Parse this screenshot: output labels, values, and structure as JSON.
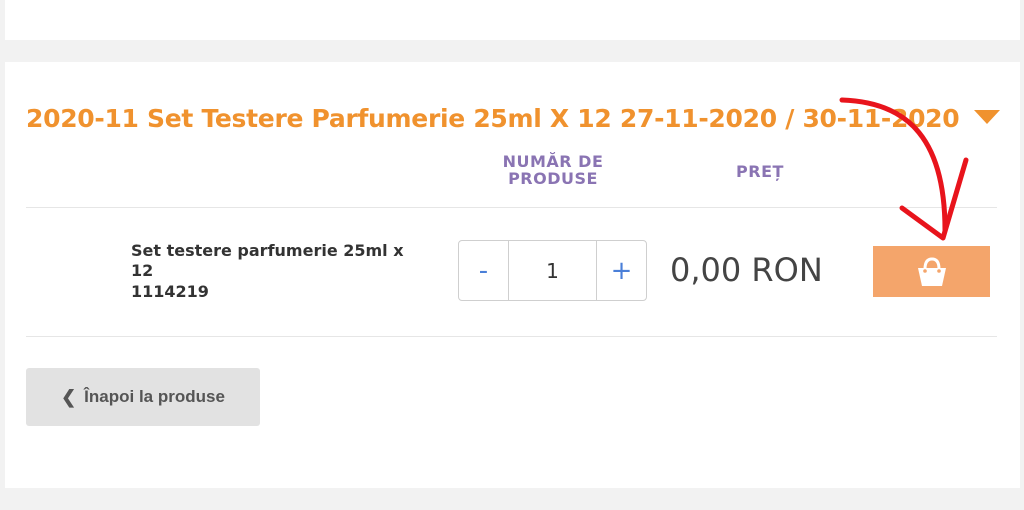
{
  "section": {
    "title": "2020-11 Set Testere Parfumerie 25ml X 12 27-11-2020 / 30-11-2020"
  },
  "columns": {
    "quantity_header": "NUMĂR DE PRODUSE",
    "price_header": "PREȚ"
  },
  "product": {
    "name": "Set testere parfumerie 25ml x 12",
    "code": "1114219",
    "quantity": "1",
    "decrement_label": "-",
    "increment_label": "+",
    "price": "0,00 RON"
  },
  "buttons": {
    "back_label": "Înapoi la produse",
    "cart_icon": "shopping-basket-icon"
  },
  "colors": {
    "accent_orange": "#f0922e",
    "cart_button": "#f4a56b",
    "header_purple": "#8a74b3",
    "annotation_red": "#e8141c"
  }
}
